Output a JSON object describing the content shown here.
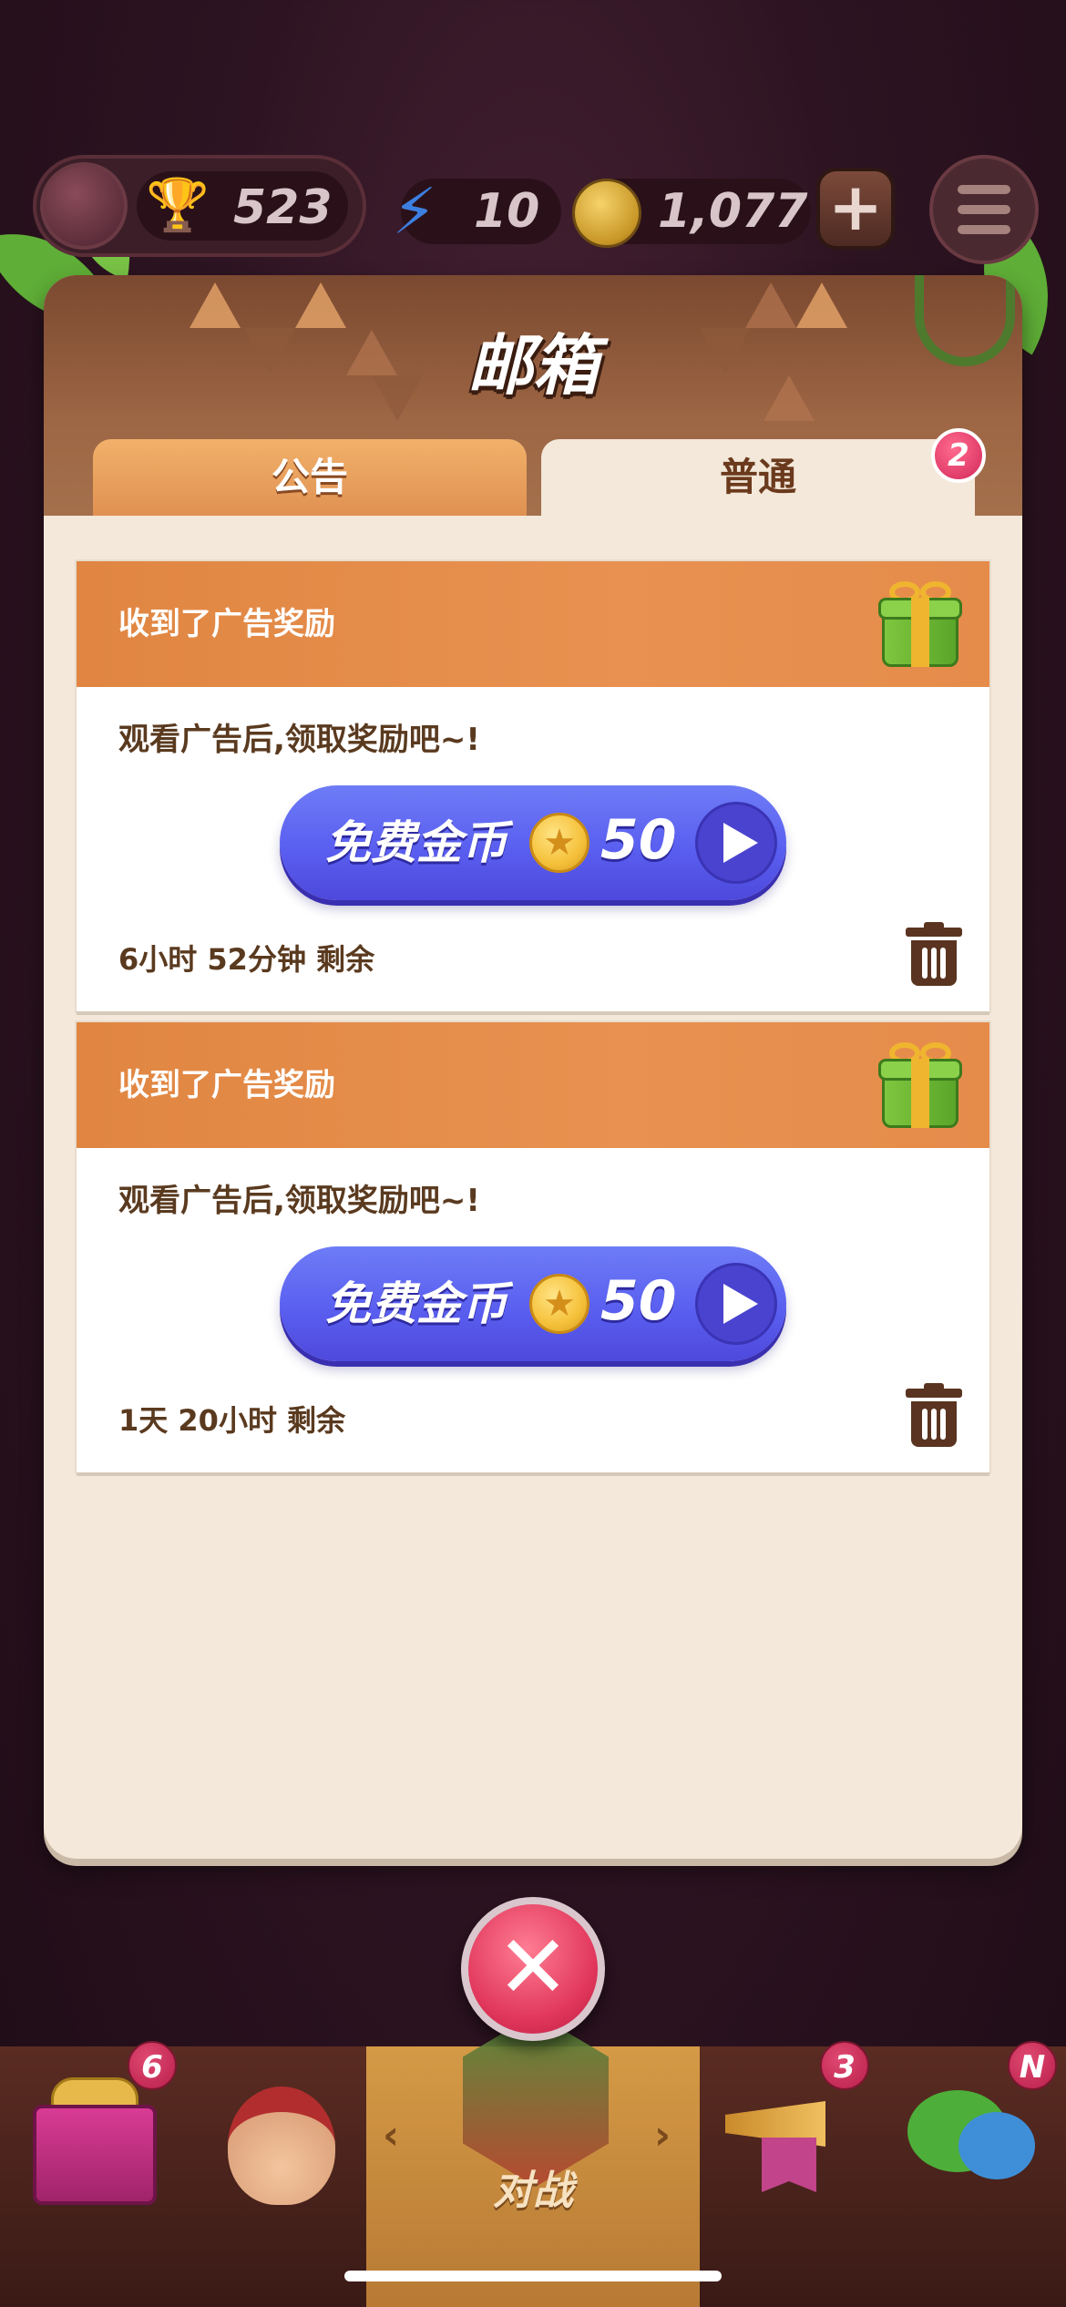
{
  "hud": {
    "trophies": "523",
    "energy": "10",
    "coins": "1,077",
    "add_icon": "plus-icon",
    "menu_icon": "hamburger-menu-icon"
  },
  "dialog": {
    "title": "邮箱",
    "tabs": [
      {
        "label": "公告",
        "selected": false
      },
      {
        "label": "普通",
        "selected": true,
        "badge": "2"
      }
    ]
  },
  "mails": [
    {
      "title": "收到了广告奖励",
      "description": "观看广告后,领取奖励吧~!",
      "button_label": "免费金币",
      "amount": "50",
      "remaining": "6小时 52分钟 剩余"
    },
    {
      "title": "收到了广告奖励",
      "description": "观看广告后,领取奖励吧~!",
      "button_label": "免费金币",
      "amount": "50",
      "remaining": "1天 20小时 剩余"
    }
  ],
  "bottom_nav": {
    "shop_badge": "6",
    "battle_label": "对战",
    "events_badge": "3",
    "chat_badge": "N"
  },
  "colors": {
    "accent_orange": "#e08642",
    "button_blue": "#5a5ff0",
    "close_red": "#e0355a",
    "panel_bg": "#f3e8da"
  }
}
